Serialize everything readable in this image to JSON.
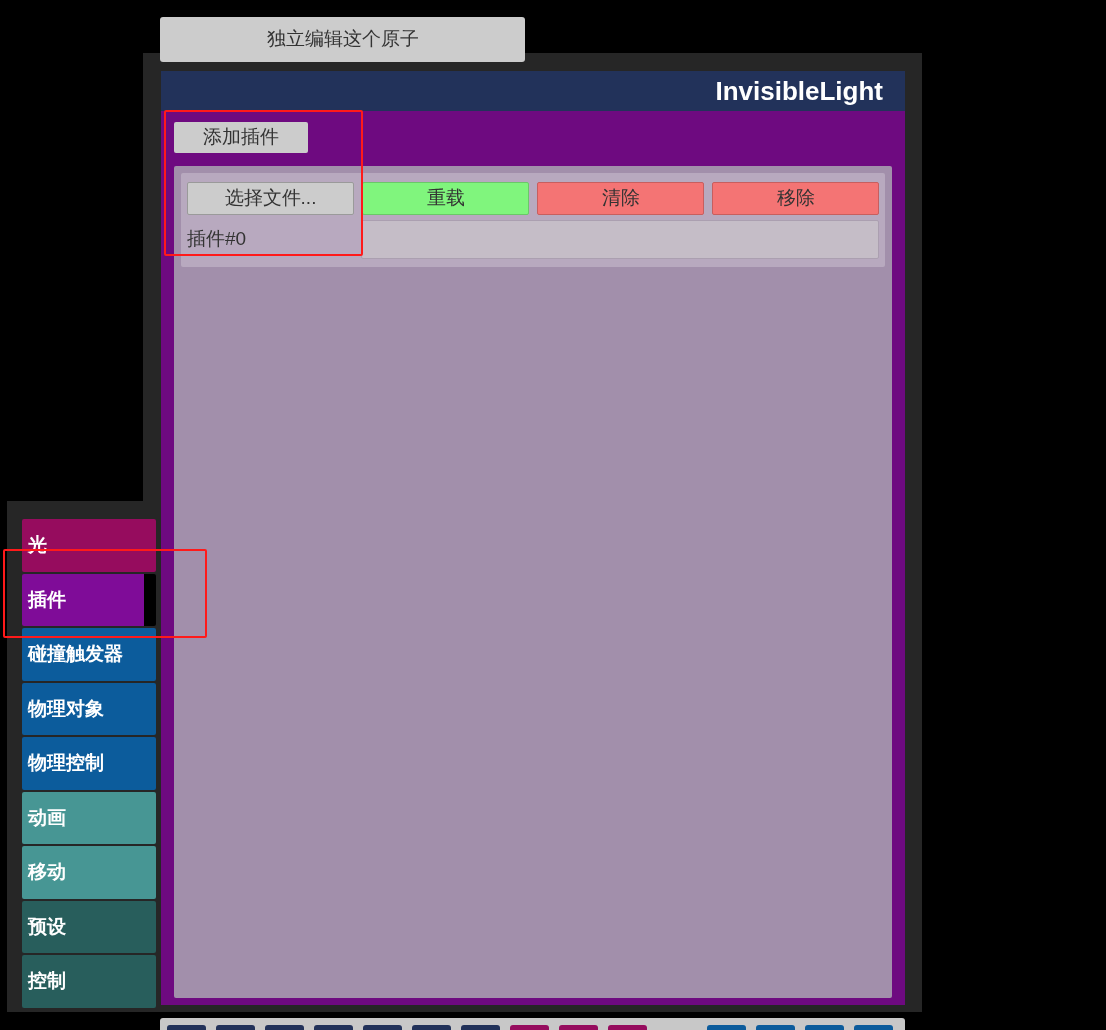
{
  "edit_button": {
    "label": "独立编辑这个原子"
  },
  "panel": {
    "title": "InvisibleLight",
    "add_button": {
      "label": "添加插件"
    },
    "plugins": [
      {
        "label": "插件#0",
        "buttons": [
          {
            "label": "选择文件...",
            "kind": "neutral"
          },
          {
            "label": "重载",
            "kind": "reload"
          },
          {
            "label": "清除",
            "kind": "danger"
          },
          {
            "label": "移除",
            "kind": "danger"
          }
        ]
      }
    ]
  },
  "tabs": [
    {
      "label": "光",
      "color": "#960c5e",
      "selected": false
    },
    {
      "label": "插件",
      "color": "#7f0c98",
      "selected": true
    },
    {
      "label": "碰撞触发器",
      "color": "#0c5c9c",
      "selected": false
    },
    {
      "label": "物理对象",
      "color": "#0c5c9c",
      "selected": false
    },
    {
      "label": "物理控制",
      "color": "#0c5c9c",
      "selected": false
    },
    {
      "label": "动画",
      "color": "#479694",
      "selected": false
    },
    {
      "label": "移动",
      "color": "#479694",
      "selected": false
    },
    {
      "label": "预设",
      "color": "#285e5c",
      "selected": false
    },
    {
      "label": "控制",
      "color": "#285e5c",
      "selected": false
    }
  ],
  "bottom_bar": {
    "buttons": [
      {
        "color": "#22325a"
      },
      {
        "color": "#22325a"
      },
      {
        "color": "#22325a"
      },
      {
        "color": "#22325a"
      },
      {
        "color": "#22325a"
      },
      {
        "color": "#22325a"
      },
      {
        "color": "#22325a"
      },
      {
        "color": "#960c5e"
      },
      {
        "color": "#960c5e"
      },
      {
        "color": "#960c5e"
      },
      {
        "color": "#0c5c9c"
      },
      {
        "color": "#0c5c9c"
      },
      {
        "color": "#0c5c9c"
      },
      {
        "color": "#0c5c9c"
      }
    ]
  },
  "highlights": [
    {
      "kind": "highlight"
    },
    {
      "kind": "highlight"
    }
  ]
}
